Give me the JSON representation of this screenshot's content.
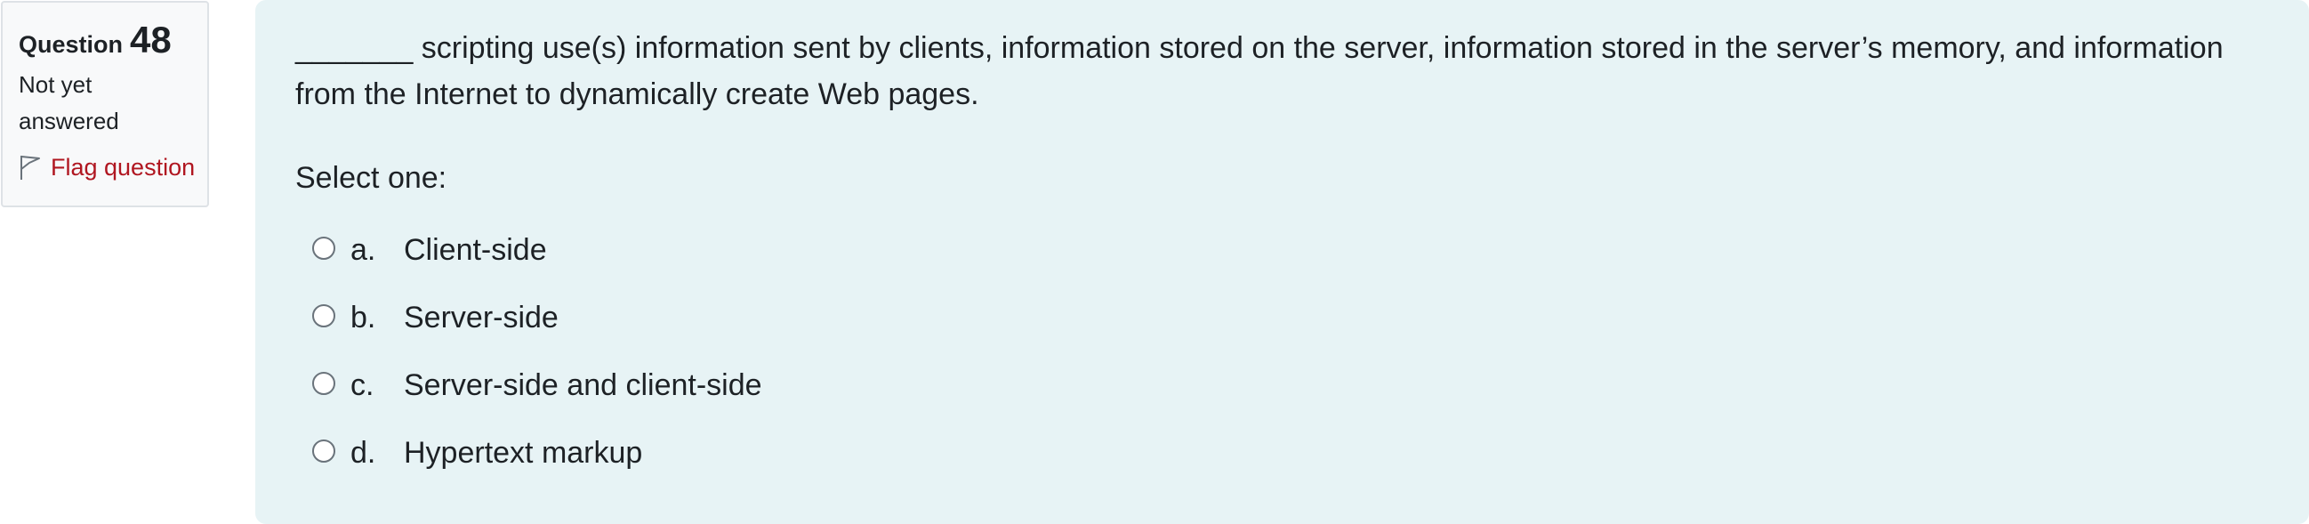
{
  "question_info": {
    "label": "Question",
    "number": "48",
    "state": "Not yet answered",
    "flag_label": "Flag question",
    "flag_icon": "flag-icon"
  },
  "question": {
    "text": "_______ scripting use(s) information sent by clients, information stored on the server, information stored in the server’s memory, and information from the Internet to dynamically create Web pages.",
    "prompt": "Select one:",
    "answers": [
      {
        "letter": "a.",
        "text": "Client-side",
        "selected": false
      },
      {
        "letter": "b.",
        "text": "Server-side",
        "selected": false
      },
      {
        "letter": "c.",
        "text": "Server-side and client-side",
        "selected": false
      },
      {
        "letter": "d.",
        "text": "Hypertext markup",
        "selected": false
      }
    ]
  },
  "colors": {
    "panel_background": "#e7f3f5",
    "info_background": "#f8f9fa",
    "flag_text": "#b01620"
  }
}
